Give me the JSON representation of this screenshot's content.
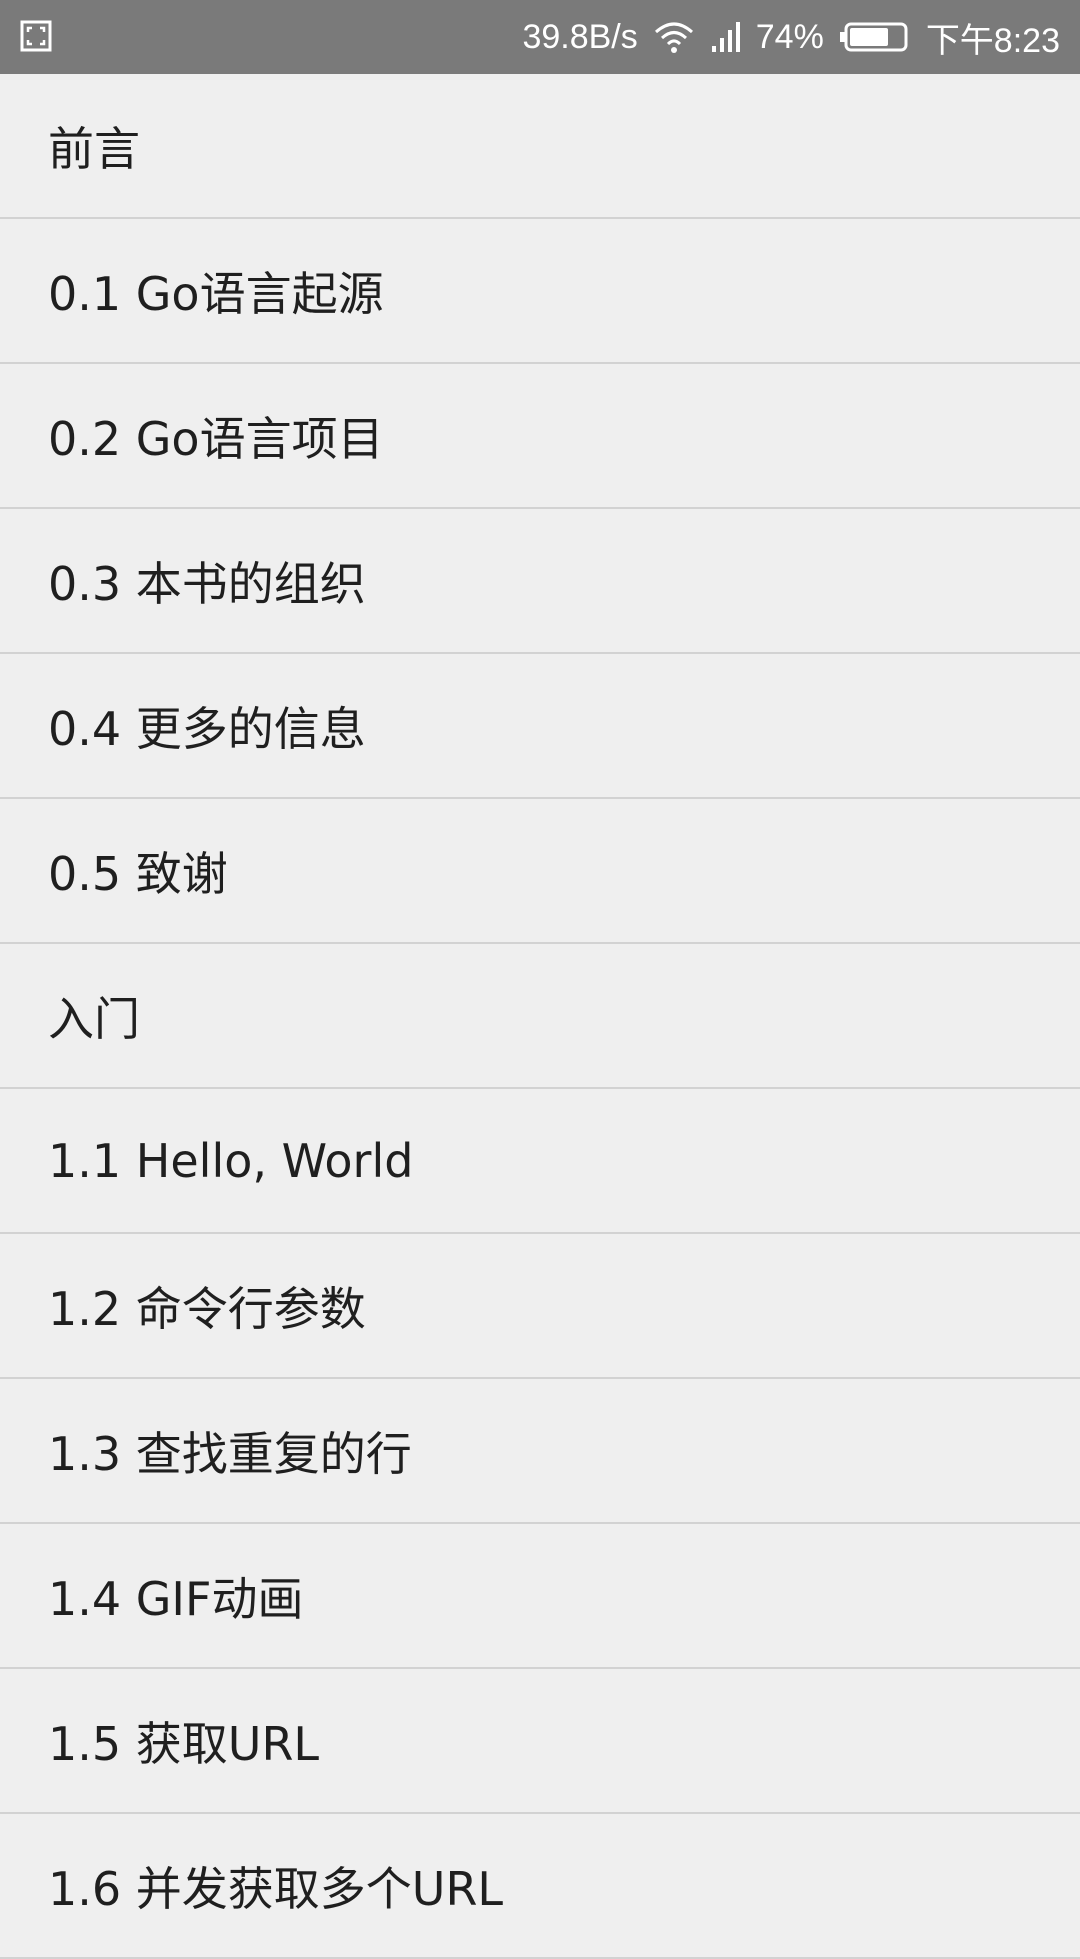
{
  "status_bar": {
    "screenshot_icon": "screenshot-frame-icon",
    "net_speed": "39.8B/s",
    "wifi_icon": "wifi-icon",
    "signal_icon": "signal-icon",
    "battery_percent": "74%",
    "battery_icon": "battery-icon",
    "battery_level": 0.74,
    "time": "下午8:23"
  },
  "toc": {
    "items": [
      {
        "label": "前言"
      },
      {
        "label": "0.1 Go语言起源"
      },
      {
        "label": "0.2 Go语言项目"
      },
      {
        "label": "0.3 本书的组织"
      },
      {
        "label": "0.4 更多的信息"
      },
      {
        "label": "0.5 致谢"
      },
      {
        "label": "入门"
      },
      {
        "label": "1.1 Hello, World"
      },
      {
        "label": "1.2 命令行参数"
      },
      {
        "label": "1.3 查找重复的行"
      },
      {
        "label": "1.4 GIF动画"
      },
      {
        "label": "1.5 获取URL"
      },
      {
        "label": "1.6 并发获取多个URL"
      }
    ]
  },
  "colors": {
    "status_bar_bg": "#7a7a7a",
    "list_bg": "#efefef",
    "divider": "#d2d2d2",
    "text": "#1f1f1f"
  }
}
